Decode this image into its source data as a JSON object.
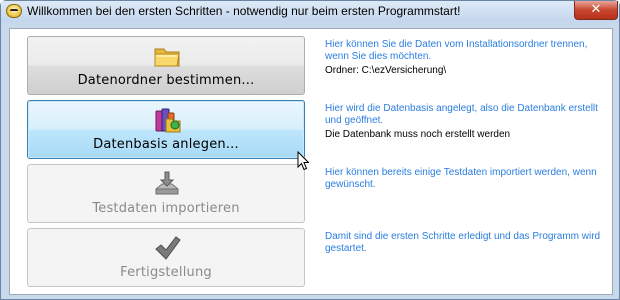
{
  "window": {
    "title": "Willkommen bei den ersten Schritten - notwendig nur beim ersten Programmstart!",
    "close_label": "✕"
  },
  "steps": [
    {
      "label": "Datenordner bestimmen...",
      "icon": "folder-icon",
      "state": "normal",
      "description": "Hier können Sie die Daten vom Installationsordner trennen, wenn Sie dies möchten.",
      "status": "Ordner: C:\\ezVersicherung\\"
    },
    {
      "label": "Datenbasis anlegen...",
      "icon": "database-books-icon",
      "state": "active",
      "description": "Hier wird die Datenbasis angelegt, also die Datenbank erstellt und geöffnet.",
      "status": "Die Datenbank muss noch erstellt werden"
    },
    {
      "label": "Testdaten importieren",
      "icon": "import-tray-icon",
      "state": "disabled",
      "description": "Hier können bereits einige Testdaten importiert werden, wenn gewünscht.",
      "status": ""
    },
    {
      "label": "Fertigstellung",
      "icon": "checkmark-icon",
      "state": "disabled",
      "description": "Damit sind die ersten Schritte erledigt und das Programm wird gestartet.",
      "status": ""
    }
  ],
  "colors": {
    "description_text": "#2a7ee0",
    "active_button": "#bee6fd",
    "close_button": "#c9472e"
  }
}
